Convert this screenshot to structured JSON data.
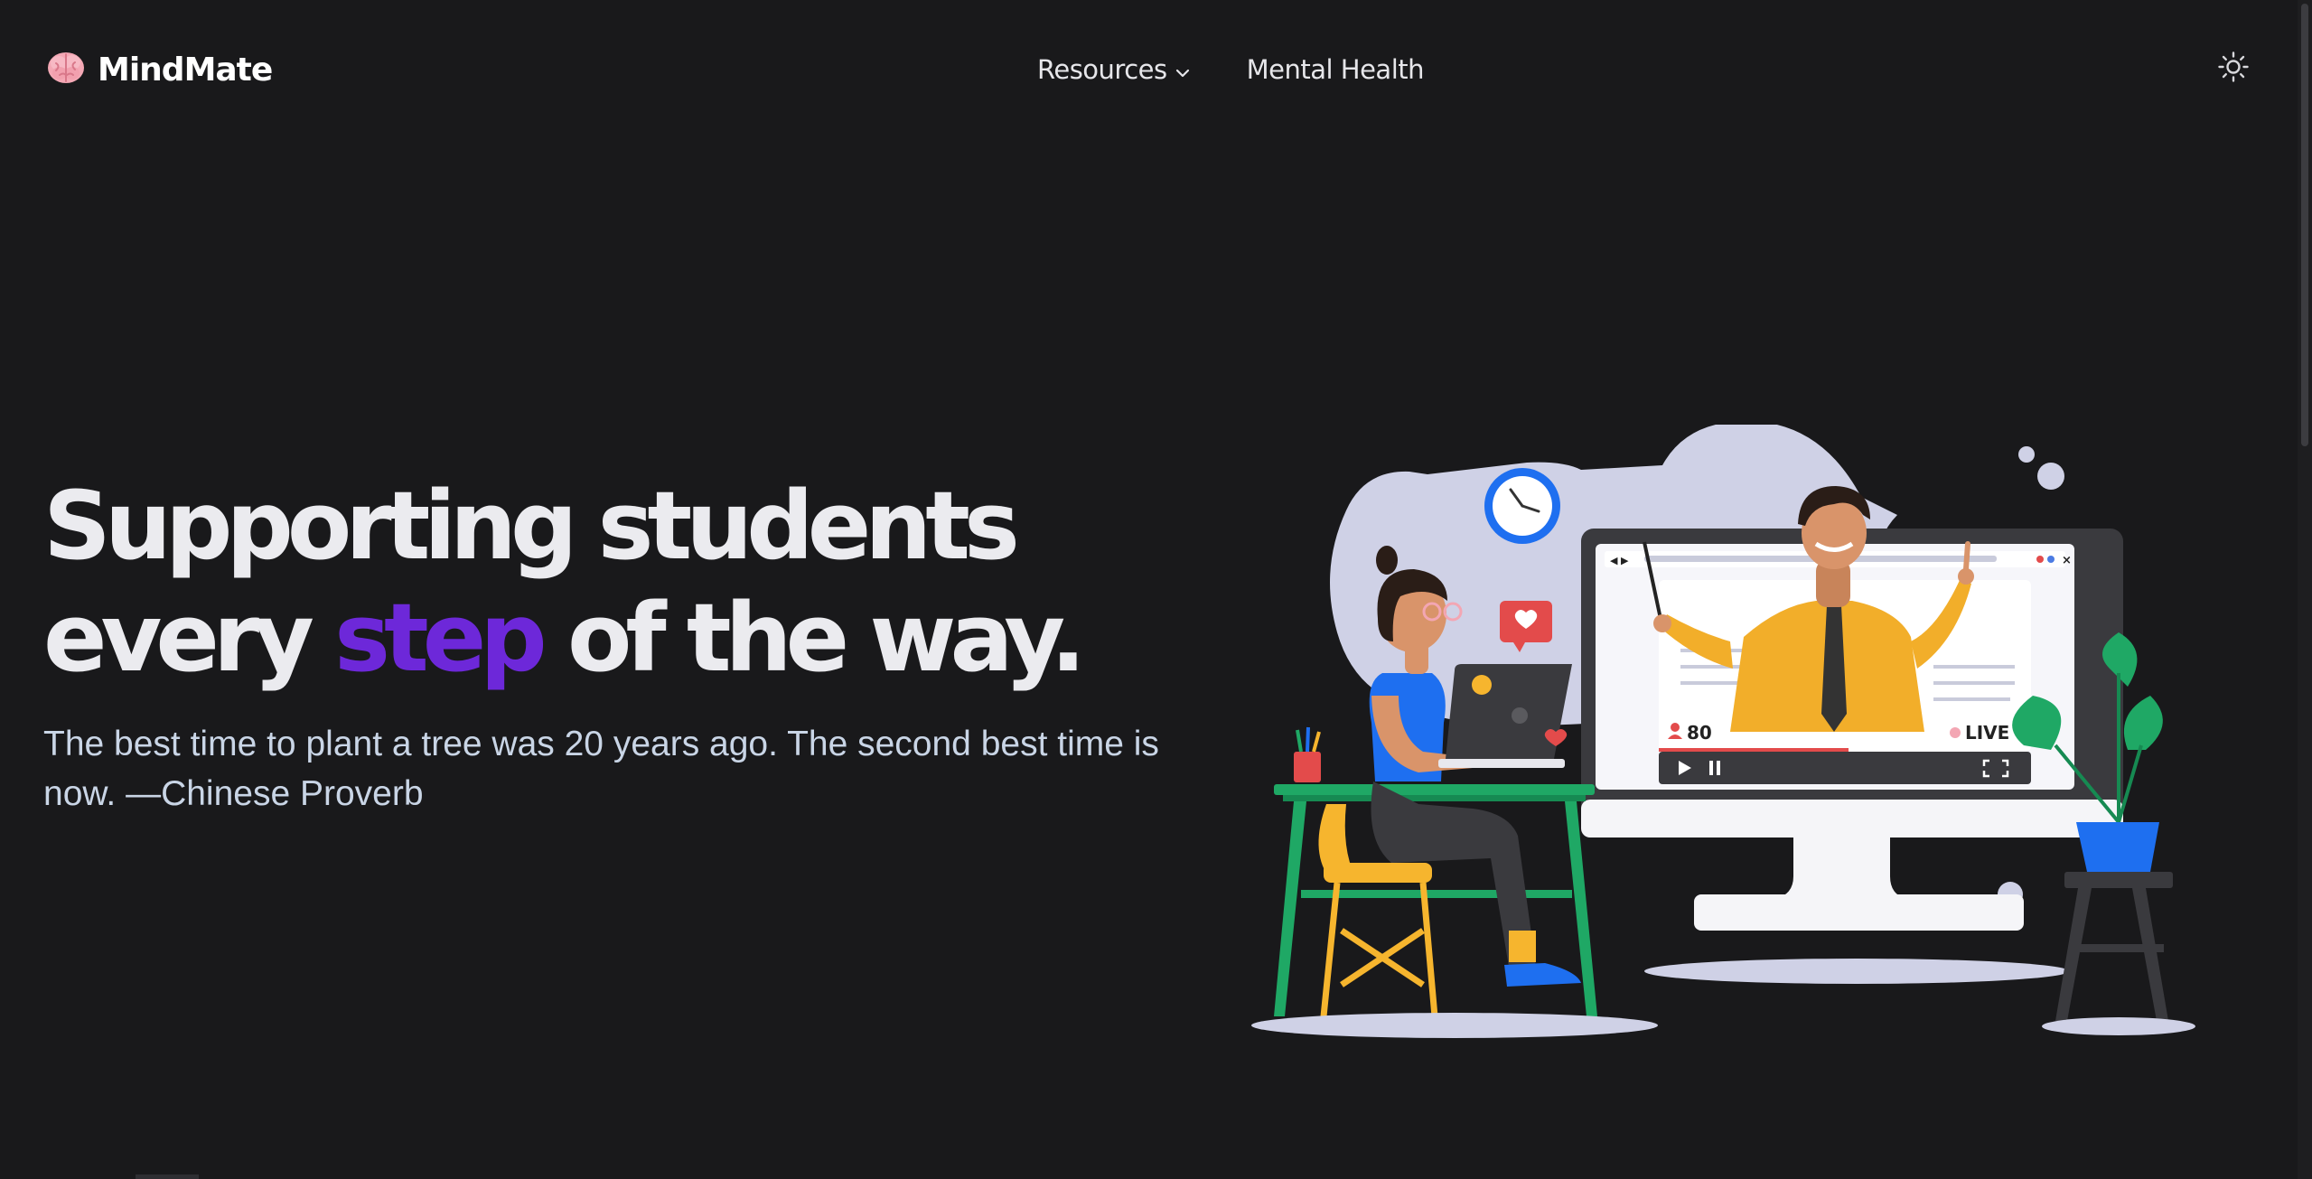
{
  "brand": {
    "name": "MindMate",
    "logo_icon": "brain-icon"
  },
  "nav": {
    "items": [
      {
        "label": "Resources",
        "has_dropdown": true,
        "icon": "chevron-down-icon"
      },
      {
        "label": "Mental Health",
        "has_dropdown": false
      }
    ],
    "theme_toggle_icon": "sun-icon"
  },
  "hero": {
    "line1": "Supporting students",
    "line2_prefix": "every ",
    "line2_accent": "step",
    "line2_suffix": " of the way.",
    "quote": "The best time to plant a tree was 20 years ago. The second best time is now. —Chinese Proverb"
  },
  "illustration": {
    "viewer_count": "80",
    "live_label": "LIVE",
    "icons": [
      "clock-icon",
      "heart-bubble-icon",
      "plant-icon",
      "play-icon",
      "pause-icon",
      "fullscreen-icon",
      "user-icon"
    ]
  },
  "colors": {
    "background": "#19191b",
    "accent": "#6d28d9",
    "heading": "#ebebef",
    "quote": "#c9d5e6",
    "blob": "#cfd1e6"
  }
}
